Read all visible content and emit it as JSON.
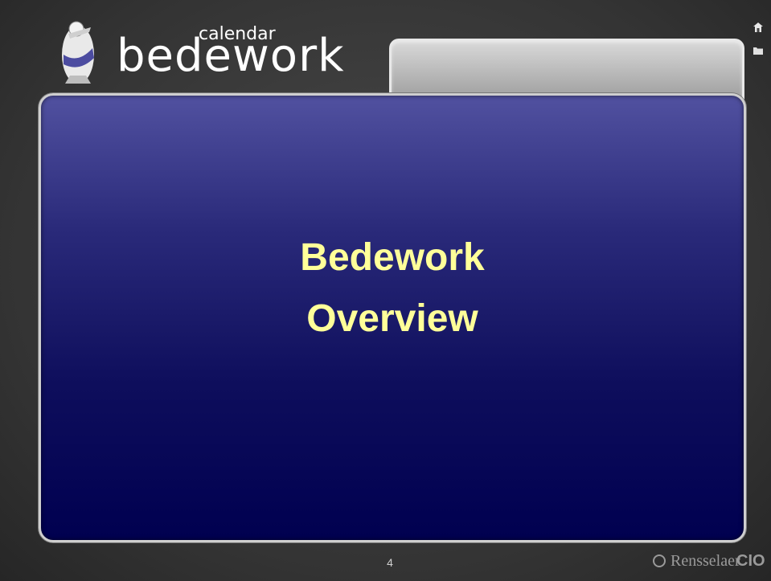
{
  "logo": {
    "wordmark": "bedework",
    "sub": "calendar"
  },
  "slide": {
    "title_line1": "Bedework",
    "title_line2": "Overview",
    "title_color": "#ffff99",
    "page_number": "4"
  },
  "footer": {
    "institution": "Rensselaer",
    "separator": "•",
    "cio": "CIO"
  },
  "icons": {
    "home": "home-icon",
    "folder": "folder-icon"
  }
}
